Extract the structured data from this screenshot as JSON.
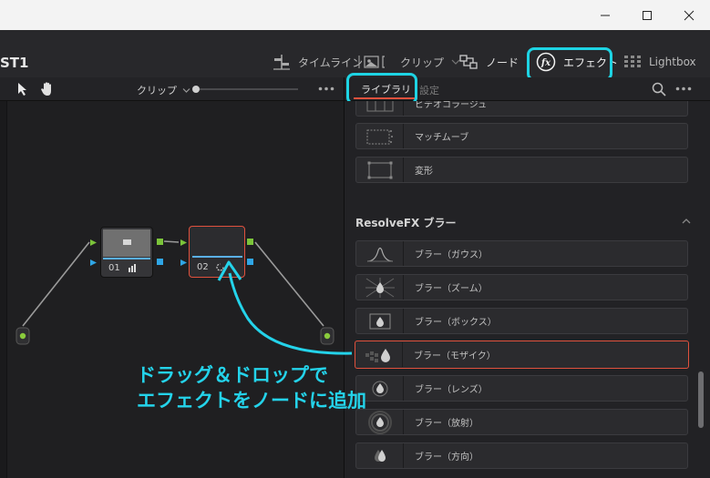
{
  "window": {
    "controls": [
      "minimize",
      "maximize",
      "close"
    ]
  },
  "header": {
    "project_title": "ST1",
    "pages": [
      {
        "label": "タイムライン",
        "icon": "timeline-icon"
      },
      {
        "label": "クリップ",
        "icon": "clip-icon"
      },
      {
        "label": "ノード",
        "icon": "node-icon"
      },
      {
        "label": "エフェクト",
        "icon": "fx-icon"
      },
      {
        "label": "Lightbox",
        "icon": "grid-icon"
      }
    ]
  },
  "node_toolbar": {
    "clip_dropdown": "クリップ"
  },
  "library": {
    "tabs": [
      {
        "label": "ライブラリ",
        "active": true
      },
      {
        "label": "設定",
        "active": false
      }
    ],
    "items_top": [
      "ビデオコラージュ",
      "マッチムーブ",
      "変形"
    ],
    "section_title": "ResolveFX ブラー",
    "blur_items": [
      "ブラー（ガウス）",
      "ブラー（ズーム）",
      "ブラー（ボックス）",
      "ブラー（モザイク）",
      "ブラー（レンズ）",
      "ブラー（放射）",
      "ブラー（方向）"
    ]
  },
  "nodes": [
    {
      "label": "01"
    },
    {
      "label": "02"
    }
  ],
  "annotation": {
    "line1": "ドラッグ＆ドロップで",
    "line2": "エフェクトをノードに追加"
  },
  "colors": {
    "highlight": "#1ed4e4",
    "selected_border": "#e0513d",
    "annotation_text": "#24d3ea",
    "port_green": "#7bc43a",
    "port_blue": "#2fa6e6"
  }
}
